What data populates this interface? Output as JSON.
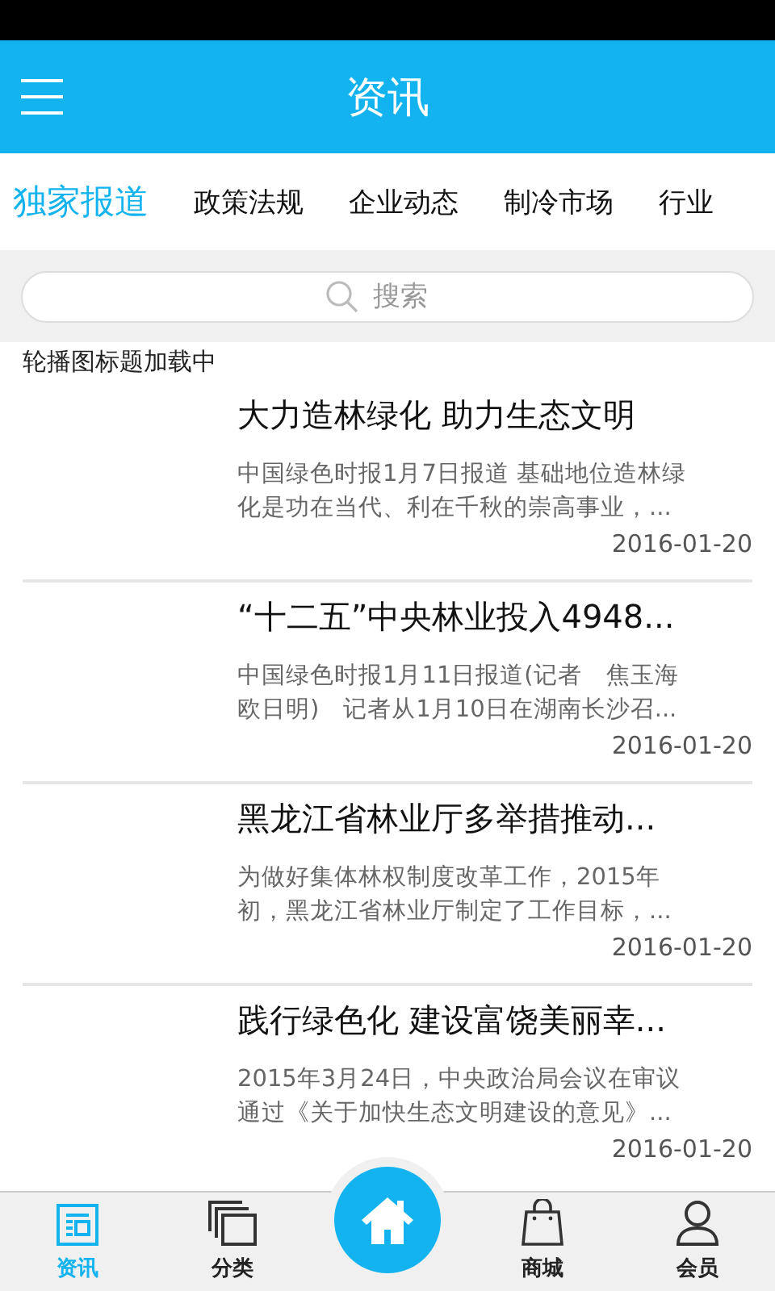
{
  "header": {
    "title": "资讯"
  },
  "tabs": [
    {
      "label": "独家报道",
      "selected": true
    },
    {
      "label": "政策法规",
      "selected": false
    },
    {
      "label": "企业动态",
      "selected": false
    },
    {
      "label": "制冷市场",
      "selected": false
    },
    {
      "label": "行业",
      "selected": false
    }
  ],
  "search": {
    "placeholder": "搜索"
  },
  "carousel": {
    "caption": "轮播图标题加载中"
  },
  "articles": [
    {
      "title": "大力造林绿化 助力生态文明",
      "summary": [
        "中国绿色时报1月7日报道 基础地位造林绿",
        "化是功在当代、利在千秋的崇高事业，..."
      ],
      "date": "2016-01-20"
    },
    {
      "title": "“十二五”中央林业投入4948...",
      "summary": [
        "中国绿色时报1月11日报道(记者　焦玉海",
        "欧日明)　记者从1月10日在湖南长沙召..."
      ],
      "date": "2016-01-20"
    },
    {
      "title": "黑龙江省林业厅多举措推动...",
      "summary": [
        "为做好集体林权制度改革工作，2015年",
        "初，黑龙江省林业厅制定了工作目标，..."
      ],
      "date": "2016-01-20"
    },
    {
      "title": "践行绿色化 建设富饶美丽幸...",
      "summary": [
        "2015年3月24日，中央政治局会议在审议",
        "通过《关于加快生态文明建设的意见》..."
      ],
      "date": "2016-01-20"
    }
  ],
  "bottom_nav": [
    {
      "label": "资讯",
      "selected": true,
      "kind": "news"
    },
    {
      "label": "分类",
      "selected": false,
      "kind": "category"
    },
    {
      "kind": "home",
      "selected": false
    },
    {
      "label": "商城",
      "selected": false,
      "kind": "shop"
    },
    {
      "label": "会员",
      "selected": false,
      "kind": "member"
    }
  ]
}
